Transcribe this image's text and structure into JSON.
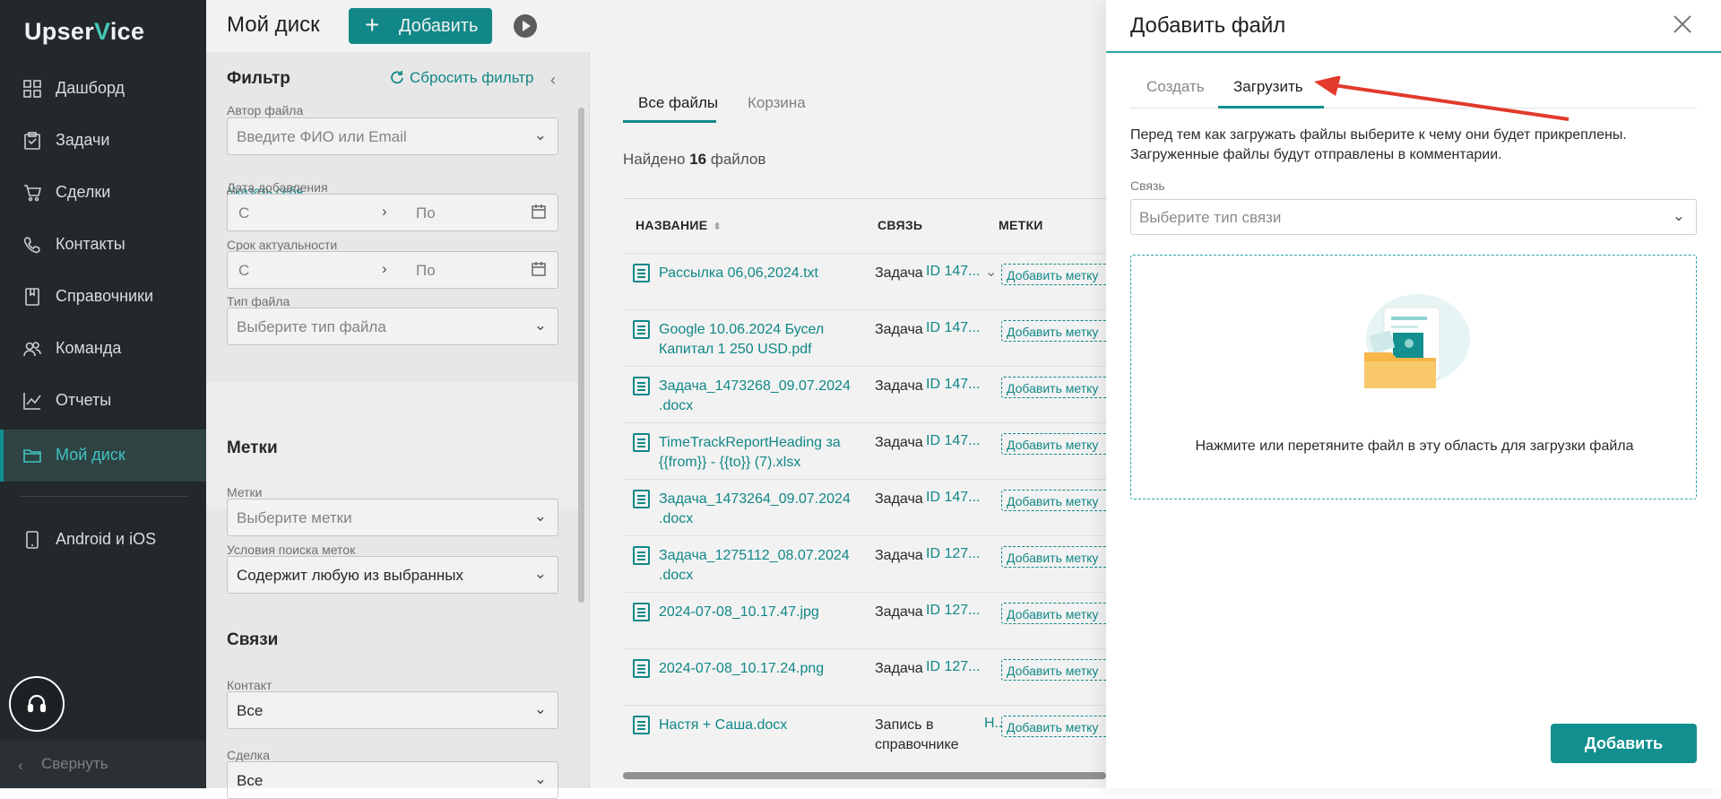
{
  "brand": {
    "logo_a": "Upser",
    "logo_tick": "V",
    "logo_b": "ice"
  },
  "sidebar": {
    "items": [
      {
        "label": "Дашборд",
        "icon": "dashboard-icon"
      },
      {
        "label": "Задачи",
        "icon": "tasks-icon"
      },
      {
        "label": "Сделки",
        "icon": "deals-icon"
      },
      {
        "label": "Контакты",
        "icon": "contacts-icon"
      },
      {
        "label": "Справочники",
        "icon": "book-icon"
      },
      {
        "label": "Команда",
        "icon": "team-icon"
      },
      {
        "label": "Отчеты",
        "icon": "chart-icon"
      },
      {
        "label": "Мой диск",
        "icon": "folder-icon",
        "active": true
      },
      {
        "label": "Android и iOS",
        "icon": "phone-icon"
      }
    ],
    "collapse_label": "Свернуть"
  },
  "header": {
    "title": "Мой диск",
    "add_label": "Добавить"
  },
  "filter": {
    "title": "Фильтр",
    "reset_label": "Сбросить фильтр",
    "author_label": "Автор файла",
    "author_placeholder": "Введите ФИО или Email",
    "self_link": "Указать себя",
    "date_added_label": "Дата добавления",
    "date_from": "С",
    "date_to": "По",
    "relevance_label": "Срок актуальности",
    "filetype_label": "Тип файла",
    "filetype_placeholder": "Выберите тип файла",
    "tags_section": "Метки",
    "tags_label": "Метки",
    "tags_placeholder": "Выберите метки",
    "tags_condition_label": "Условия поиска меток",
    "tags_condition_value": "Содержит любую из выбранных",
    "links_section": "Связи",
    "contact_label": "Контакт",
    "contact_value": "Все",
    "deal_label": "Сделка",
    "deal_value": "Все"
  },
  "files": {
    "tabs": [
      "Все файлы",
      "Корзина"
    ],
    "found_prefix": "Найдено",
    "found_count": "16",
    "found_suffix": "файлов",
    "columns": [
      "НАЗВАНИЕ",
      "СВЯЗЬ",
      "МЕТКИ"
    ],
    "rows": [
      {
        "name": "Рассылка 06,06,2024.txt",
        "link_type": "Задача",
        "link_id": "ID 147...",
        "tag": "Добавить метку"
      },
      {
        "name": "Google 10.06.2024 Бусел Капитал 1 250 USD.pdf",
        "link_type": "Задача",
        "link_id": "ID 147...",
        "tag": "Добавить метку"
      },
      {
        "name": "Задача_1473268_09.07.2024 .docx",
        "link_type": "Задача",
        "link_id": "ID 147...",
        "tag": "Добавить метку"
      },
      {
        "name": "TimeTrackReportHeading за {{from}} - {{to}} (7).xlsx",
        "link_type": "Задача",
        "link_id": "ID 147...",
        "tag": "Добавить метку"
      },
      {
        "name": "Задача_1473264_09.07.2024 .docx",
        "link_type": "Задача",
        "link_id": "ID 147...",
        "tag": "Добавить метку"
      },
      {
        "name": "Задача_1275112_08.07.2024 .docx",
        "link_type": "Задача",
        "link_id": "ID 127...",
        "tag": "Добавить метку"
      },
      {
        "name": "2024-07-08_10.17.47.jpg",
        "link_type": "Задача",
        "link_id": "ID 127...",
        "tag": "Добавить метку"
      },
      {
        "name": "2024-07-08_10.17.24.png",
        "link_type": "Задача",
        "link_id": "ID 127...",
        "tag": "Добавить метку"
      },
      {
        "name": "Настя + Саша.docx",
        "link_type": "Запись в справочнике",
        "link_id": "Н..",
        "tag": "Добавить метку"
      }
    ]
  },
  "modal": {
    "title": "Добавить файл",
    "tabs": [
      "Создать",
      "Загрузить"
    ],
    "description": "Перед тем как загружать файлы выберите к чему они будет прикреплены. Загруженные файлы будут отправлены в комментарии.",
    "link_label": "Связь",
    "link_placeholder": "Выберите тип связи",
    "dropzone_text": "Нажмите или перетяните файл в эту область для загрузки файла",
    "submit_label": "Добавить"
  }
}
